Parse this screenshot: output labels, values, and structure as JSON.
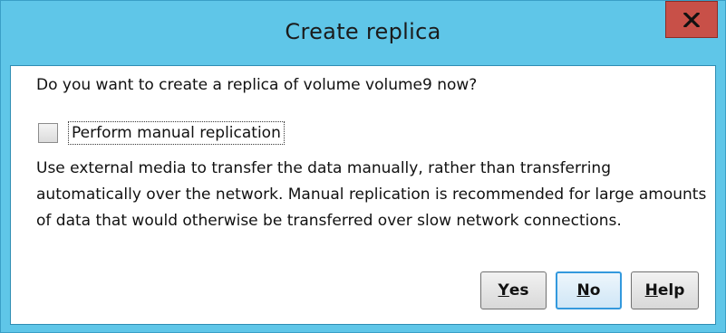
{
  "window": {
    "title": "Create replica",
    "close_label": "x"
  },
  "dialog": {
    "question": "Do you want to create a replica of volume volume9 now?",
    "checkbox": {
      "label": "Perform manual replication",
      "checked": false
    },
    "description": "Use external media to transfer the data manually, rather than transferring automatically over the network. Manual replication is recommended for large amounts of data that would otherwise be transferred over slow network connections."
  },
  "buttons": {
    "yes": {
      "mnemonic": "Y",
      "rest": "es"
    },
    "no": {
      "mnemonic": "N",
      "rest": "o"
    },
    "help": {
      "mnemonic": "H",
      "rest": "elp"
    }
  },
  "colors": {
    "titlebar": "#5fc6e8",
    "close_button": "#c85048",
    "default_button_border": "#3399dd"
  }
}
